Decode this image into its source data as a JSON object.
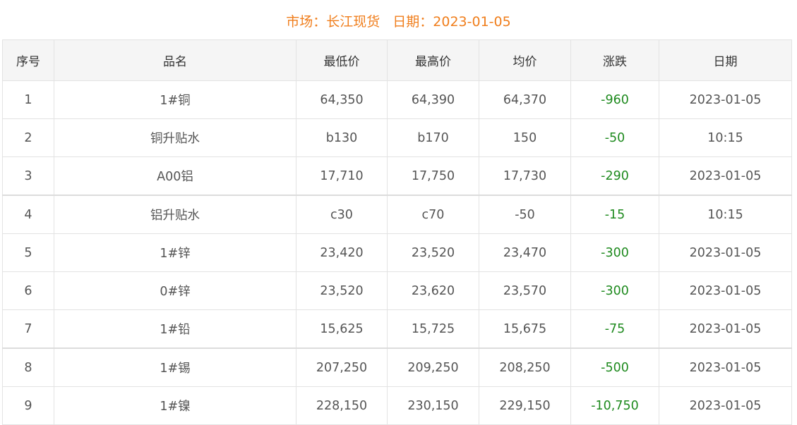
{
  "caption": {
    "market_label": "市场：长江现货",
    "date_label": "日期：2023-01-05"
  },
  "table": {
    "headers": [
      "序号",
      "品名",
      "最低价",
      "最高价",
      "均价",
      "涨跌",
      "日期"
    ],
    "rows": [
      {
        "no": "1",
        "name": "1#铜",
        "low": "64,350",
        "high": "64,390",
        "avg": "64,370",
        "change": "-960",
        "date": "2023-01-05"
      },
      {
        "no": "2",
        "name": "铜升贴水",
        "low": "b130",
        "high": "b170",
        "avg": "150",
        "change": "-50",
        "date": "10:15"
      },
      {
        "no": "3",
        "name": "A00铝",
        "low": "17,710",
        "high": "17,750",
        "avg": "17,730",
        "change": "-290",
        "date": "2023-01-05"
      },
      {
        "no": "4",
        "name": "铝升贴水",
        "low": "c30",
        "high": "c70",
        "avg": "-50",
        "change": "-15",
        "date": "10:15"
      },
      {
        "no": "5",
        "name": "1#锌",
        "low": "23,420",
        "high": "23,520",
        "avg": "23,470",
        "change": "-300",
        "date": "2023-01-05"
      },
      {
        "no": "6",
        "name": "0#锌",
        "low": "23,520",
        "high": "23,620",
        "avg": "23,570",
        "change": "-300",
        "date": "2023-01-05"
      },
      {
        "no": "7",
        "name": "1#铅",
        "low": "15,625",
        "high": "15,725",
        "avg": "15,675",
        "change": "-75",
        "date": "2023-01-05"
      },
      {
        "no": "8",
        "name": "1#锡",
        "low": "207,250",
        "high": "209,250",
        "avg": "208,250",
        "change": "-500",
        "date": "2023-01-05"
      },
      {
        "no": "9",
        "name": "1#镍",
        "low": "228,150",
        "high": "230,150",
        "avg": "229,150",
        "change": "-10,750",
        "date": "2023-01-05"
      }
    ]
  },
  "colors": {
    "caption": "#f07e1c",
    "change_down": "#1e8a1e",
    "header_bg": "#f5f5f5",
    "border": "#e3e3e3"
  }
}
